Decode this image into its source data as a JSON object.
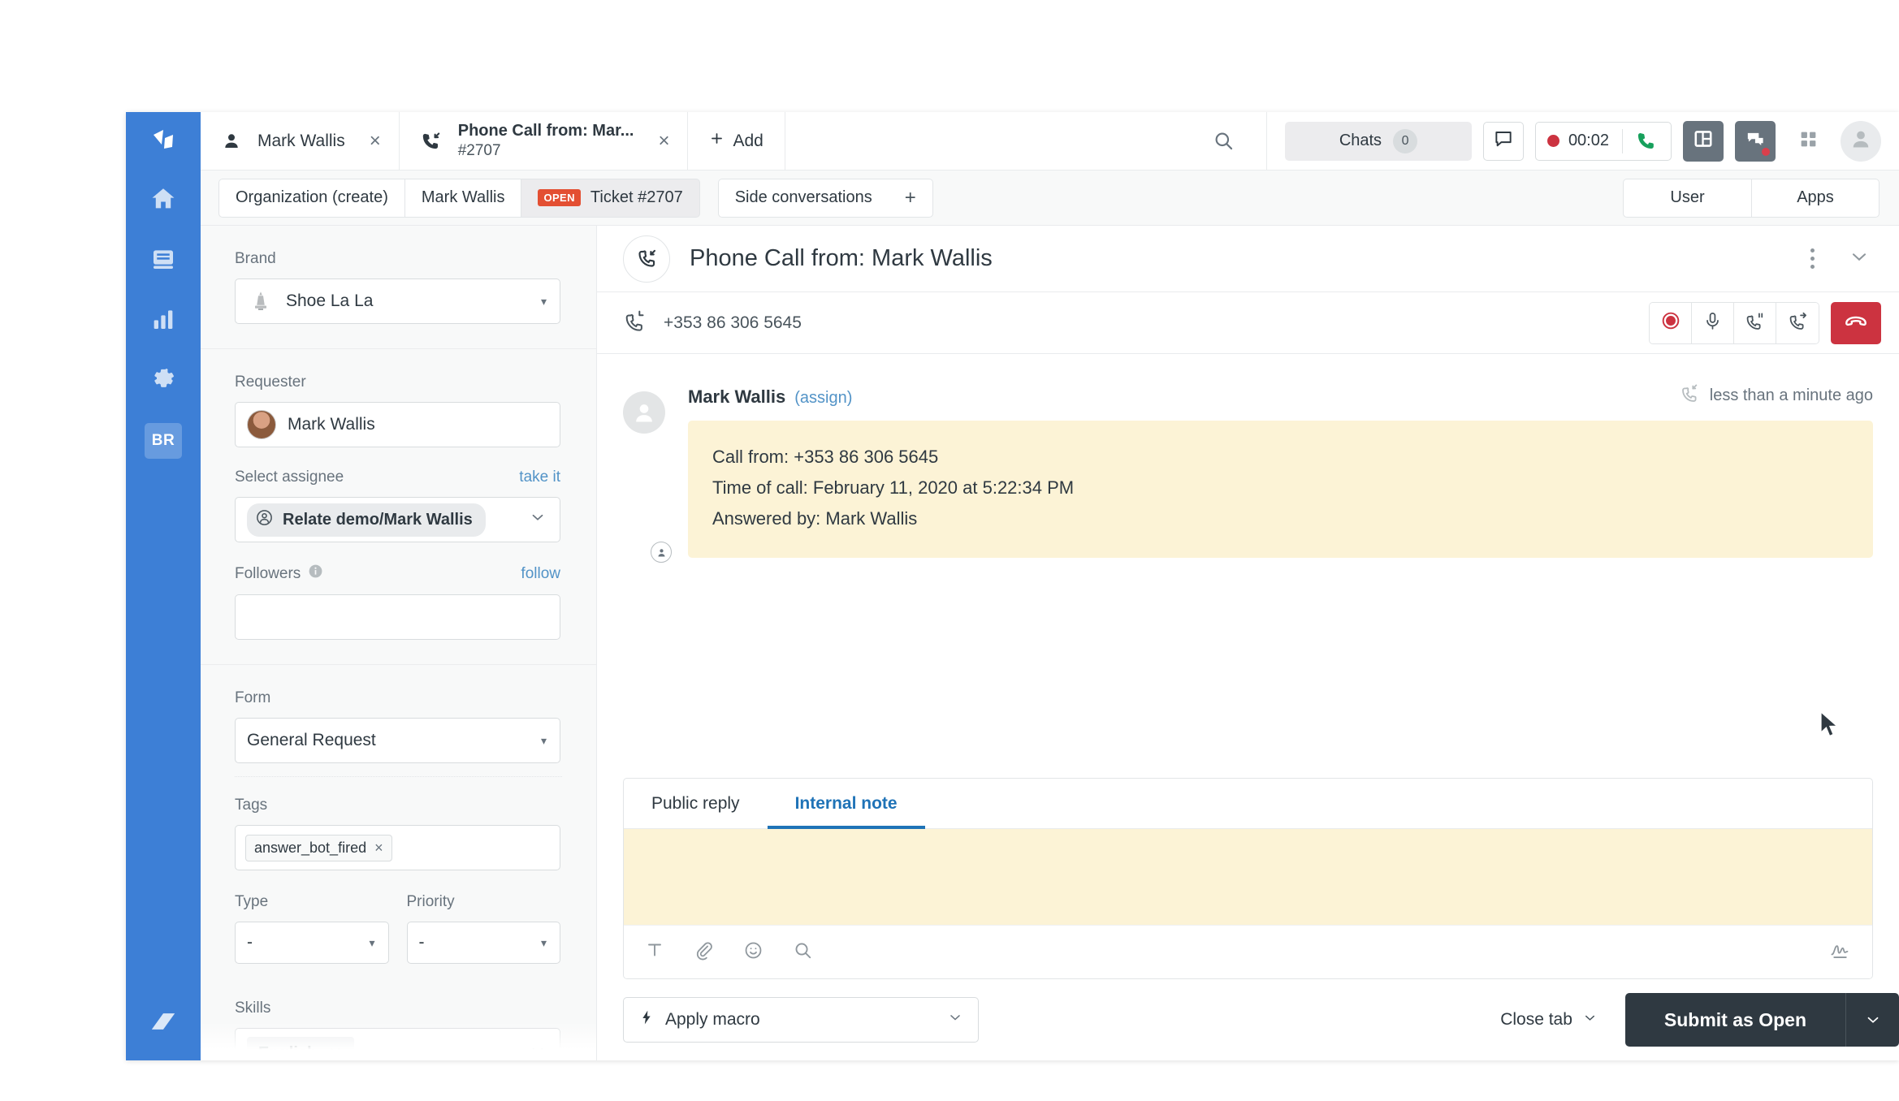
{
  "nav": {
    "logo": "zendesk-logo",
    "items": [
      {
        "name": "home",
        "icon": "home-icon"
      },
      {
        "name": "views",
        "icon": "views-icon"
      },
      {
        "name": "reporting",
        "icon": "bar-chart-icon"
      },
      {
        "name": "admin",
        "icon": "gear-icon"
      }
    ],
    "badge_label": "BR",
    "bottom_icon": "zendesk-mark"
  },
  "tabs": [
    {
      "title": "Mark Wallis",
      "subtitle": "",
      "icon": "user-icon",
      "close": "×",
      "active": false
    },
    {
      "title": "Phone Call from: Mar...",
      "subtitle": "#2707",
      "icon": "incoming-call-icon",
      "close": "×",
      "active": true
    }
  ],
  "add_tab": {
    "label": "Add",
    "icon": "plus-icon"
  },
  "topbar": {
    "search_icon": "search-icon",
    "chats_label": "Chats",
    "chats_count": "0",
    "message_icon": "speech-bubble-icon",
    "call_timer": "00:02",
    "record_icon": "record-dot-icon",
    "phone_icon": "phone-handset-icon",
    "layout_icon": "panel-layout-icon",
    "chat_icon": "chat-bubbles-icon",
    "apps_grid_icon": "apps-grid-icon",
    "avatar_icon": "user-avatar-icon"
  },
  "breadcrumbs": {
    "group1": [
      {
        "label": "Organization (create)",
        "active": false,
        "badge": ""
      },
      {
        "label": "Mark Wallis",
        "active": false,
        "badge": ""
      },
      {
        "label": "Ticket #2707",
        "active": true,
        "badge": "OPEN"
      }
    ],
    "group2": {
      "label": "Side conversations",
      "plus": "+"
    },
    "user_btn": "User",
    "apps_btn": "Apps"
  },
  "sidebar": {
    "brand": {
      "label": "Brand",
      "value": "Shoe La La",
      "icon": "brand-crest-icon",
      "caret": "▾"
    },
    "requester": {
      "label": "Requester",
      "value": "Mark Wallis"
    },
    "assignee": {
      "label": "Select assignee",
      "action": "take it",
      "value": "Relate demo/Mark Wallis",
      "icon": "agent-icon",
      "caret": "⌄"
    },
    "followers": {
      "label": "Followers",
      "info_icon": "info-icon",
      "action": "follow",
      "value": ""
    },
    "form": {
      "label": "Form",
      "value": "General Request",
      "caret": "▾"
    },
    "tags": {
      "label": "Tags",
      "chips": [
        "answer_bot_fired"
      ],
      "remove": "×"
    },
    "type": {
      "label": "Type",
      "value": "-",
      "caret": "▾"
    },
    "priority": {
      "label": "Priority",
      "value": "-",
      "caret": "▾"
    },
    "skills": {
      "label": "Skills",
      "value": "English",
      "caret": "⌄"
    }
  },
  "ticket": {
    "icon": "incoming-call-icon",
    "title": "Phone Call from: Mark Wallis",
    "kebab": "more-options-icon",
    "collapse": "chevron-down-icon",
    "phone_number": "+353 86 306 5645",
    "phone_icon": "call-log-icon",
    "controls": [
      {
        "name": "record-button",
        "icon": "record-icon"
      },
      {
        "name": "mute-button",
        "icon": "microphone-icon"
      },
      {
        "name": "hold-button",
        "icon": "call-hold-icon"
      },
      {
        "name": "transfer-button",
        "icon": "call-transfer-icon"
      }
    ],
    "hangup": {
      "name": "hangup-button",
      "icon": "hangup-icon"
    }
  },
  "comment": {
    "author": "Mark Wallis",
    "assign_link": "(assign)",
    "timestamp": "less than a minute ago",
    "timestamp_icon": "incoming-call-icon",
    "lines": [
      "Call from: +353 86 306 5645",
      "Time of call: February 11, 2020 at 5:22:34 PM",
      "Answered by: Mark Wallis"
    ]
  },
  "composer": {
    "tabs": [
      {
        "label": "Public reply",
        "active": false
      },
      {
        "label": "Internal note",
        "active": true
      }
    ],
    "text": "",
    "toolbar": [
      {
        "name": "text-format-button",
        "icon": "text-format-icon"
      },
      {
        "name": "attach-button",
        "icon": "paperclip-icon"
      },
      {
        "name": "emoji-button",
        "icon": "smiley-icon"
      },
      {
        "name": "search-articles-button",
        "icon": "search-icon"
      }
    ],
    "right_icon": "signature-icon"
  },
  "footer": {
    "macro_label": "Apply macro",
    "macro_icon": "lightning-icon",
    "macro_caret": "⌄",
    "close_tab": "Close tab",
    "close_tab_caret": "⌄",
    "submit_label": "Submit as Open",
    "submit_caret": "⌄"
  },
  "colors": {
    "nav_blue": "#3d7fd6",
    "accent_blue": "#1f73b7",
    "link_blue": "#5293c7",
    "open_red": "#e34f32",
    "danger_red": "#cc3340",
    "note_yellow": "#fcf3d6",
    "dark_button": "#2f3941"
  }
}
